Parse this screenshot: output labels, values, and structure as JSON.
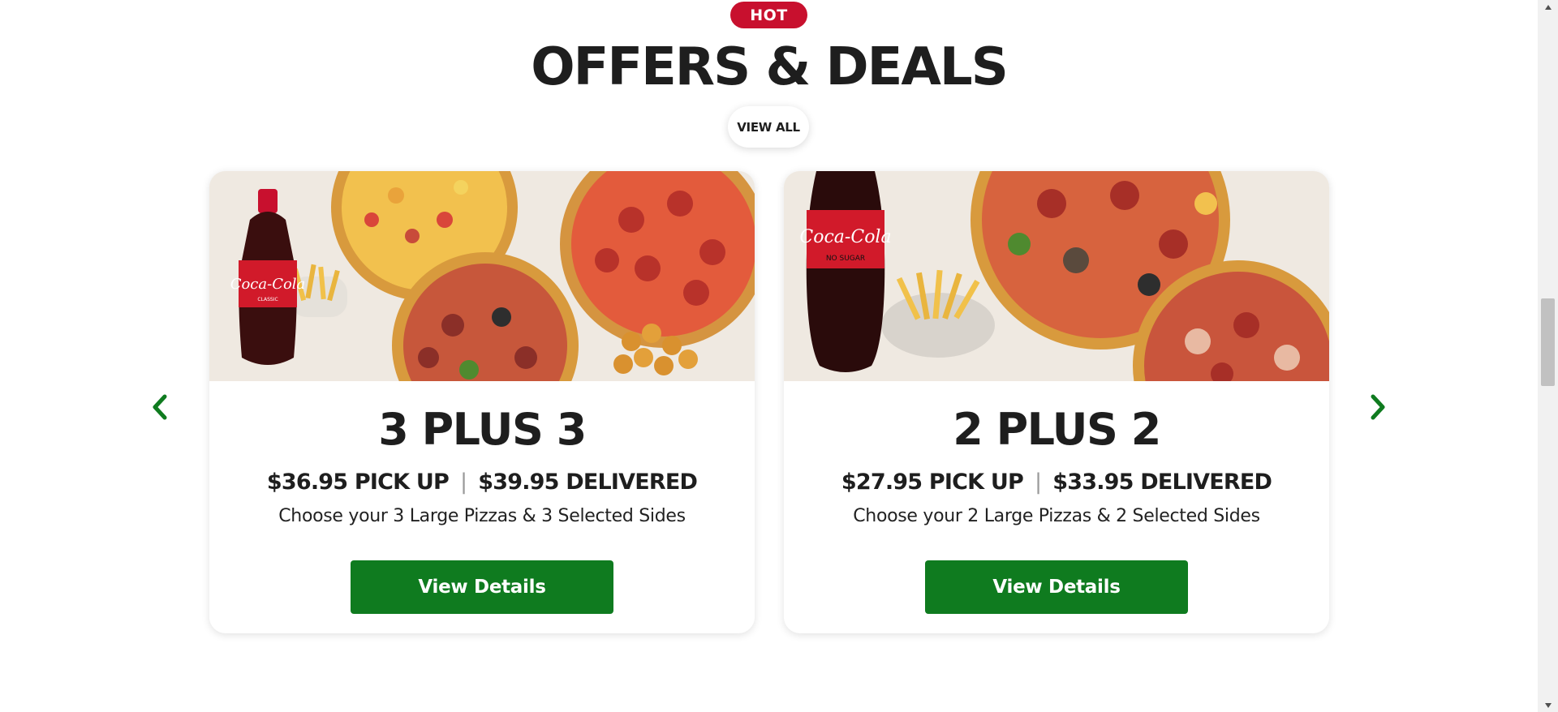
{
  "section": {
    "badge": "HOT",
    "title": "OFFERS & DEALS",
    "view_all": "VIEW ALL"
  },
  "deals": [
    {
      "title": "3 PLUS 3",
      "pickup_price": "$36.95 PICK UP",
      "separator": "|",
      "delivered_price": "$39.95 DELIVERED",
      "description": "Choose your 3 Large Pizzas & 3 Selected Sides",
      "button": "View Details",
      "image_alt": "Coca-Cola Classic bottle with three pizzas, fries and potato gems"
    },
    {
      "title": "2 PLUS 2",
      "pickup_price": "$27.95 PICK UP",
      "separator": "|",
      "delivered_price": "$33.95 DELIVERED",
      "description": "Choose your 2 Large Pizzas & 2 Selected Sides",
      "button": "View Details",
      "image_alt": "Coca-Cola No Sugar bottle with two pizzas and fries"
    }
  ],
  "carousel": {
    "prev_icon": "chevron-left-icon",
    "next_icon": "chevron-right-icon"
  },
  "colors": {
    "brand_red": "#c8102e",
    "button_green": "#0f7b1f",
    "arrow_green": "#0f7b1f",
    "title_text": "#1e1e1e"
  }
}
